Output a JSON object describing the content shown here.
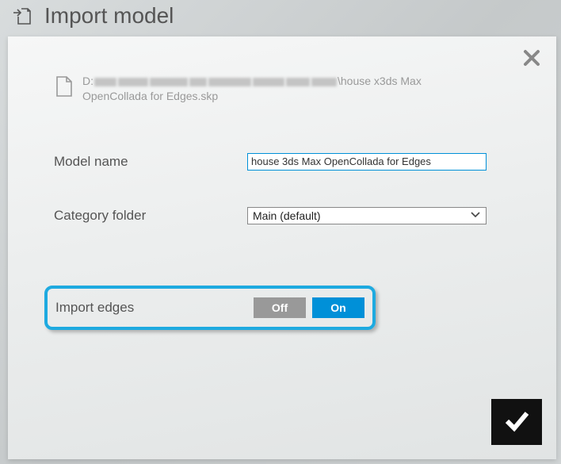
{
  "header": {
    "title": "Import model"
  },
  "file": {
    "prefix": "D:",
    "suffix": "\\house x3ds Max OpenCollada for Edges.skp"
  },
  "form": {
    "model_name_label": "Model name",
    "model_name_value": "house 3ds Max OpenCollada for Edges",
    "category_label": "Category folder",
    "category_value": "Main (default)"
  },
  "import_edges": {
    "label": "Import edges",
    "off_label": "Off",
    "on_label": "On"
  }
}
